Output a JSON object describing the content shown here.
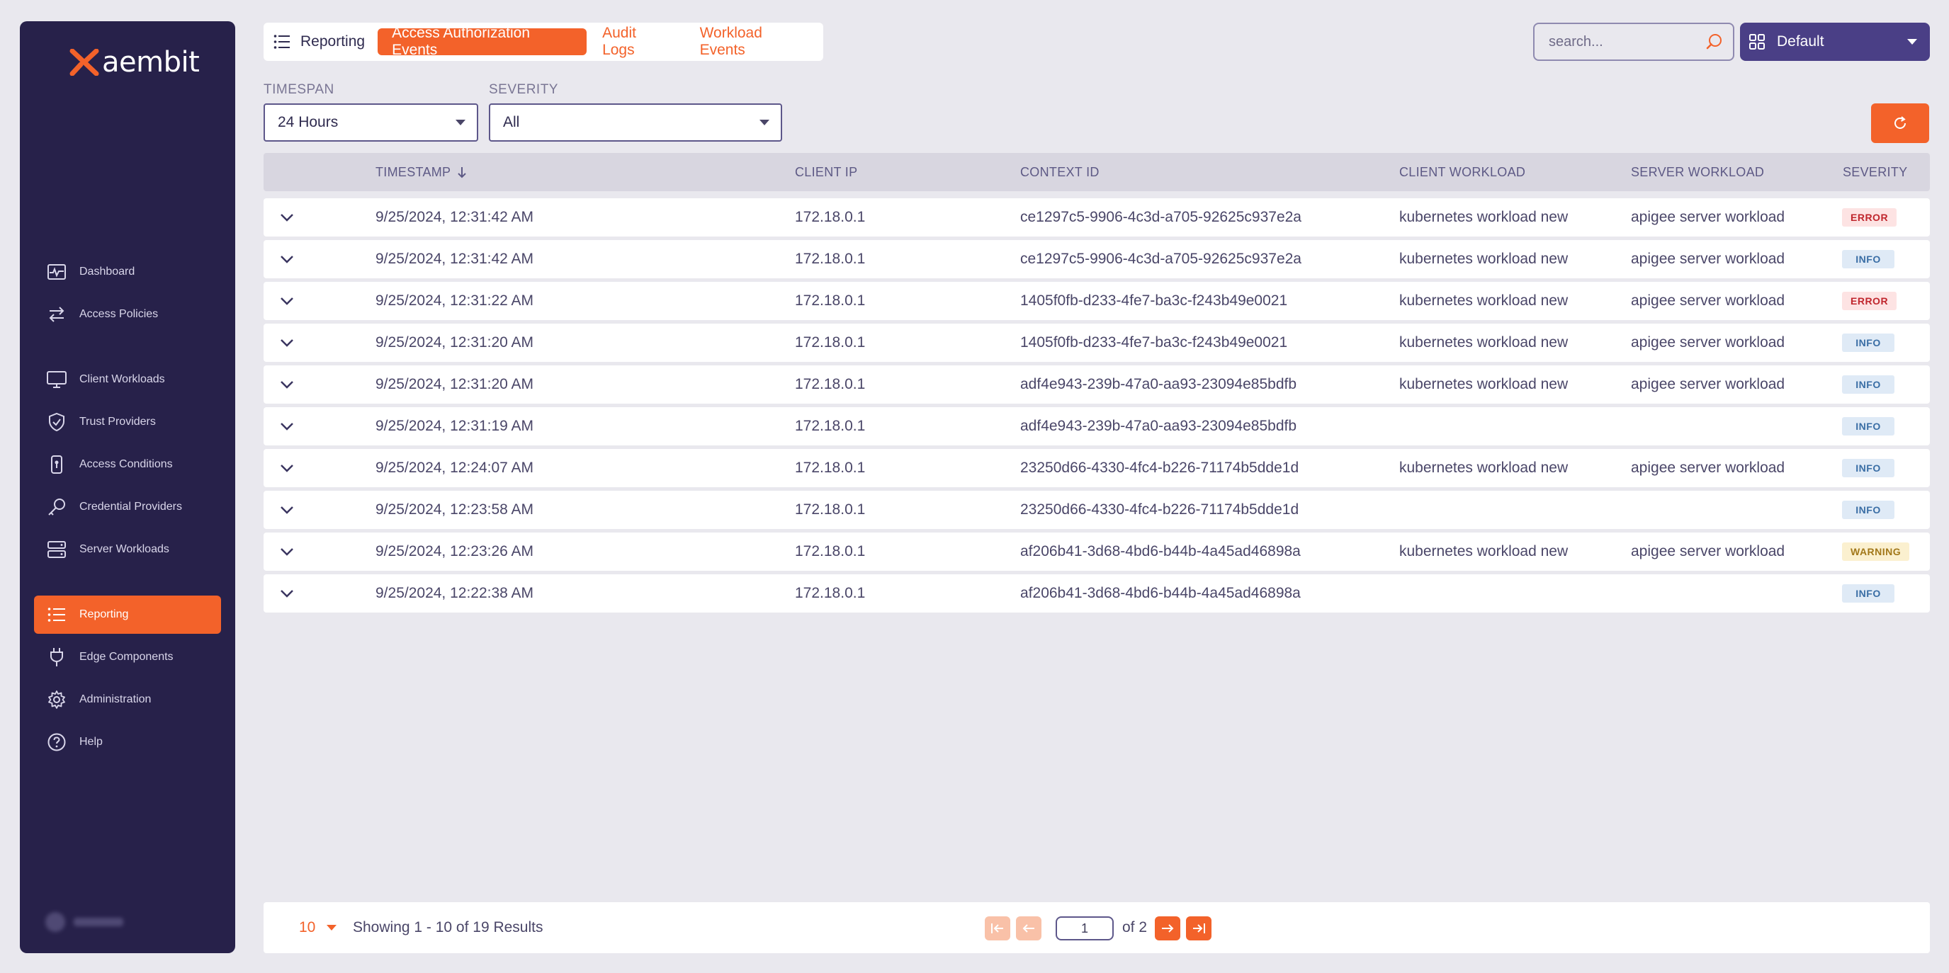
{
  "brand": {
    "name": "aembit"
  },
  "sidebar": {
    "items": [
      {
        "label": "Dashboard",
        "icon": "dashboard-icon"
      },
      {
        "label": "Access Policies",
        "icon": "arrows-exchange-icon"
      },
      {
        "label": "Client Workloads",
        "icon": "monitor-icon"
      },
      {
        "label": "Trust Providers",
        "icon": "shield-check-icon"
      },
      {
        "label": "Access Conditions",
        "icon": "lock-vertical-icon"
      },
      {
        "label": "Credential Providers",
        "icon": "key-icon"
      },
      {
        "label": "Server Workloads",
        "icon": "server-icon"
      },
      {
        "label": "Reporting",
        "icon": "list-icon",
        "active": true
      },
      {
        "label": "Edge Components",
        "icon": "plug-icon"
      },
      {
        "label": "Administration",
        "icon": "gear-icon"
      },
      {
        "label": "Help",
        "icon": "help-circle-icon"
      }
    ]
  },
  "header": {
    "home_label": "Reporting",
    "tabs": [
      {
        "label": "Access Authorization Events",
        "active": true
      },
      {
        "label": "Audit Logs"
      },
      {
        "label": "Workload Events"
      }
    ],
    "search_placeholder": "search...",
    "resource_set": "Default"
  },
  "filters": {
    "timespan_label": "TIMESPAN",
    "timespan_value": "24 Hours",
    "severity_label": "SEVERITY",
    "severity_value": "All"
  },
  "table": {
    "columns": {
      "timestamp": "TIMESTAMP",
      "client_ip": "CLIENT IP",
      "context_id": "CONTEXT ID",
      "client_workload": "CLIENT WORKLOAD",
      "server_workload": "SERVER WORKLOAD",
      "severity": "SEVERITY"
    },
    "rows": [
      {
        "timestamp": "9/25/2024, 12:31:42 AM",
        "client_ip": "172.18.0.1",
        "context_id": "ce1297c5-9906-4c3d-a705-92625c937e2a",
        "client_workload": "kubernetes workload new",
        "server_workload": "apigee server workload",
        "severity": "ERROR"
      },
      {
        "timestamp": "9/25/2024, 12:31:42 AM",
        "client_ip": "172.18.0.1",
        "context_id": "ce1297c5-9906-4c3d-a705-92625c937e2a",
        "client_workload": "kubernetes workload new",
        "server_workload": "apigee server workload",
        "severity": "INFO"
      },
      {
        "timestamp": "9/25/2024, 12:31:22 AM",
        "client_ip": "172.18.0.1",
        "context_id": "1405f0fb-d233-4fe7-ba3c-f243b49e0021",
        "client_workload": "kubernetes workload new",
        "server_workload": "apigee server workload",
        "severity": "ERROR"
      },
      {
        "timestamp": "9/25/2024, 12:31:20 AM",
        "client_ip": "172.18.0.1",
        "context_id": "1405f0fb-d233-4fe7-ba3c-f243b49e0021",
        "client_workload": "kubernetes workload new",
        "server_workload": "apigee server workload",
        "severity": "INFO"
      },
      {
        "timestamp": "9/25/2024, 12:31:20 AM",
        "client_ip": "172.18.0.1",
        "context_id": "adf4e943-239b-47a0-aa93-23094e85bdfb",
        "client_workload": "kubernetes workload new",
        "server_workload": "apigee server workload",
        "severity": "INFO"
      },
      {
        "timestamp": "9/25/2024, 12:31:19 AM",
        "client_ip": "172.18.0.1",
        "context_id": "adf4e943-239b-47a0-aa93-23094e85bdfb",
        "client_workload": "",
        "server_workload": "",
        "severity": "INFO"
      },
      {
        "timestamp": "9/25/2024, 12:24:07 AM",
        "client_ip": "172.18.0.1",
        "context_id": "23250d66-4330-4fc4-b226-71174b5dde1d",
        "client_workload": "kubernetes workload new",
        "server_workload": "apigee server workload",
        "severity": "INFO"
      },
      {
        "timestamp": "9/25/2024, 12:23:58 AM",
        "client_ip": "172.18.0.1",
        "context_id": "23250d66-4330-4fc4-b226-71174b5dde1d",
        "client_workload": "",
        "server_workload": "",
        "severity": "INFO"
      },
      {
        "timestamp": "9/25/2024, 12:23:26 AM",
        "client_ip": "172.18.0.1",
        "context_id": "af206b41-3d68-4bd6-b44b-4a45ad46898a",
        "client_workload": "kubernetes workload new",
        "server_workload": "apigee server workload",
        "severity": "WARNING"
      },
      {
        "timestamp": "9/25/2024, 12:22:38 AM",
        "client_ip": "172.18.0.1",
        "context_id": "af206b41-3d68-4bd6-b44b-4a45ad46898a",
        "client_workload": "",
        "server_workload": "",
        "severity": "INFO"
      }
    ]
  },
  "pagination": {
    "page_size": "10",
    "showing_text": "Showing 1 - 10 of 19 Results",
    "current_page": "1",
    "of_text": "of 2"
  },
  "colors": {
    "accent": "#f3622a",
    "sidebar_bg": "#27214a",
    "resource_set_bg": "#4a3f86"
  }
}
